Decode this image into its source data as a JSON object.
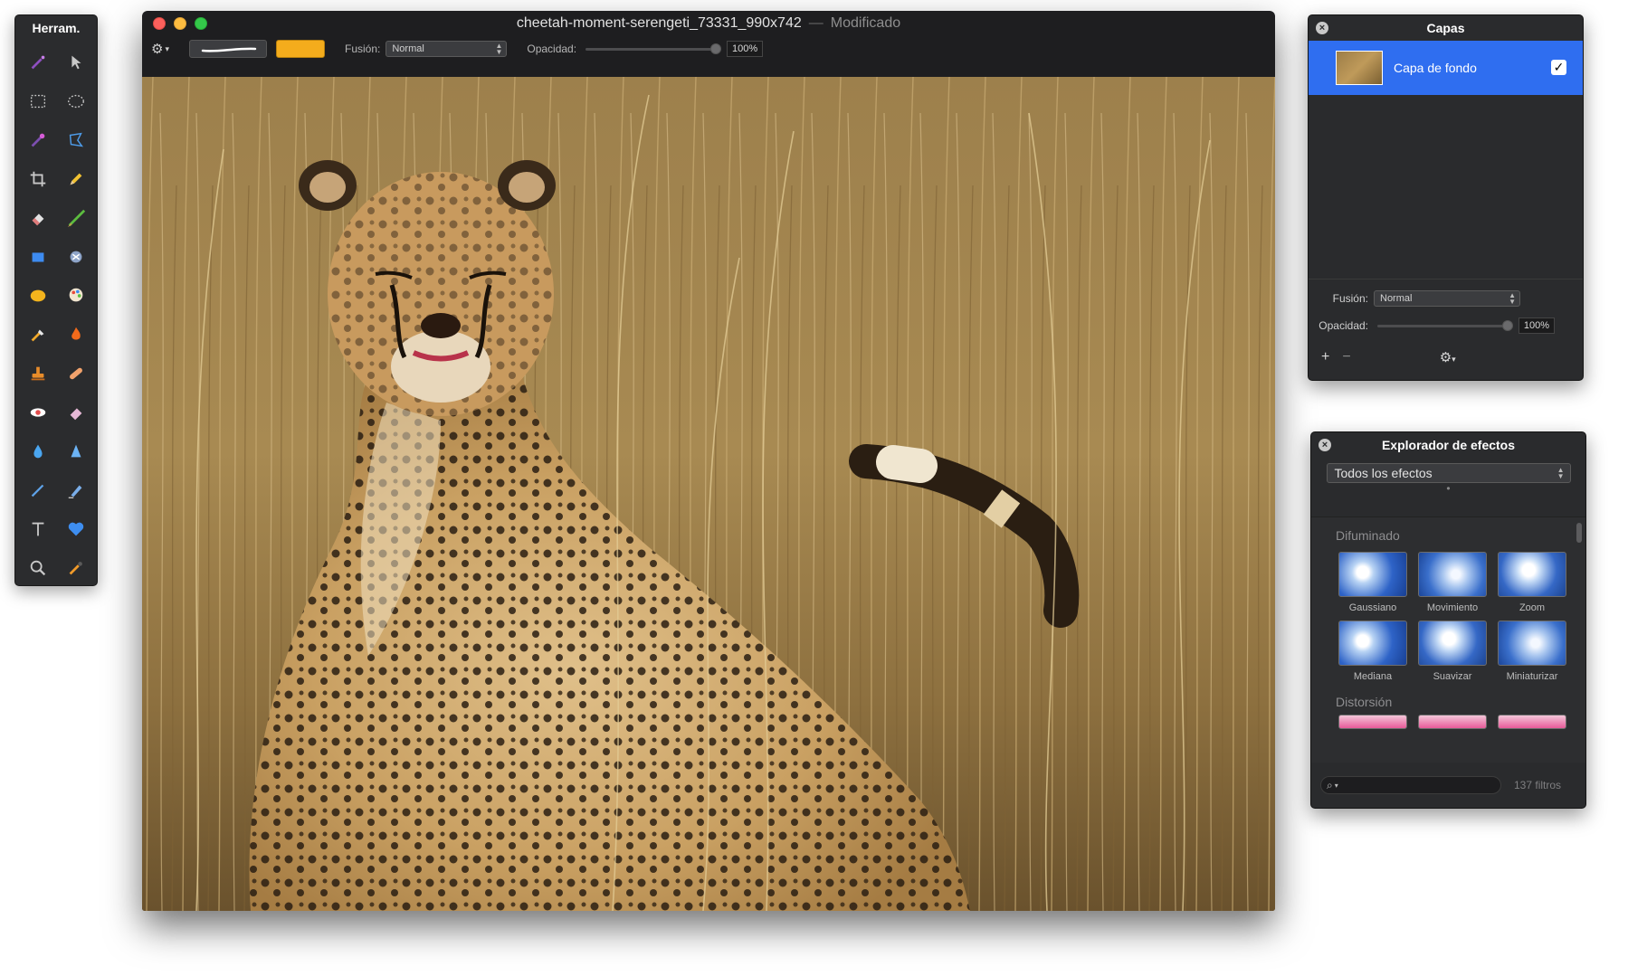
{
  "tools_palette": {
    "title": "Herram.",
    "tools": [
      {
        "name": "magic-wand-icon",
        "color": "#b55adb"
      },
      {
        "name": "arrow-select-icon",
        "color": "#c8c8c8"
      },
      {
        "name": "rect-select-icon",
        "color": "#c8c8c8"
      },
      {
        "name": "ellipse-select-icon",
        "color": "#c8c8c8"
      },
      {
        "name": "color-picker-icon",
        "color": "#d65cd6"
      },
      {
        "name": "lasso-icon",
        "color": "#4d9be8"
      },
      {
        "name": "crop-icon",
        "color": "#c8c8c8"
      },
      {
        "name": "pencil-icon",
        "color": "#f1c232"
      },
      {
        "name": "eraser-icon",
        "color": "#d8d8d8"
      },
      {
        "name": "paintbrush-icon",
        "color": "#5cbd3f"
      },
      {
        "name": "rectangle-shape-icon",
        "color": "#3d8bf0"
      },
      {
        "name": "clone-icon",
        "color": "#b7c3d8"
      },
      {
        "name": "ellipse-shape-icon",
        "color": "#f3b41d"
      },
      {
        "name": "palette-icon",
        "color": "#e96b4d"
      },
      {
        "name": "paint-bucket-icon",
        "color": "#f1a92b"
      },
      {
        "name": "flame-icon",
        "color": "#f26a1b"
      },
      {
        "name": "stamp-icon",
        "color": "#e88c2a"
      },
      {
        "name": "bandage-icon",
        "color": "#f1a26c"
      },
      {
        "name": "red-eye-icon",
        "color": "#e24d4d"
      },
      {
        "name": "smudge-eraser-icon",
        "color": "#e6b8d6"
      },
      {
        "name": "water-drop-icon",
        "color": "#4aa6f0"
      },
      {
        "name": "triangle-sharpen-icon",
        "color": "#6cb4f6"
      },
      {
        "name": "pen-icon",
        "color": "#5ea2e8"
      },
      {
        "name": "vector-pen-icon",
        "color": "#7aaee9"
      },
      {
        "name": "text-tool-icon",
        "color": "#c8c8c8"
      },
      {
        "name": "heart-shape-icon",
        "color": "#3e8ef0"
      },
      {
        "name": "zoom-icon",
        "color": "#c8c8c8"
      },
      {
        "name": "dropper-icon",
        "color": "#f19b2a"
      }
    ]
  },
  "document": {
    "title": "cheetah-moment-serengeti_73331_990x742",
    "separator": "—",
    "status": "Modificado",
    "toolbar": {
      "gear_label": "⚙",
      "color": "#f4ac1c",
      "blend_label": "Fusión:",
      "blend_value": "Normal",
      "opacity_label": "Opacidad:",
      "opacity_value": "100%",
      "opacity_fraction": 1.0
    }
  },
  "layers_panel": {
    "title": "Capas",
    "layers": [
      {
        "name": "Capa de fondo",
        "visible": true,
        "selected": true
      }
    ],
    "blend_label": "Fusión:",
    "blend_value": "Normal",
    "opacity_label": "Opacidad:",
    "opacity_value": "100%",
    "opacity_fraction": 1.0,
    "footer": {
      "add": "+",
      "remove": "−",
      "gear": "⚙"
    }
  },
  "effects_panel": {
    "title": "Explorador de efectos",
    "filter_select": "Todos los efectos",
    "sections": [
      {
        "name": "Difuminado",
        "effects": [
          "Gaussiano",
          "Movimiento",
          "Zoom",
          "Mediana",
          "Suavizar",
          "Miniaturizar"
        ]
      },
      {
        "name": "Distorsión",
        "effects": []
      }
    ],
    "count_label": "137 filtros"
  }
}
